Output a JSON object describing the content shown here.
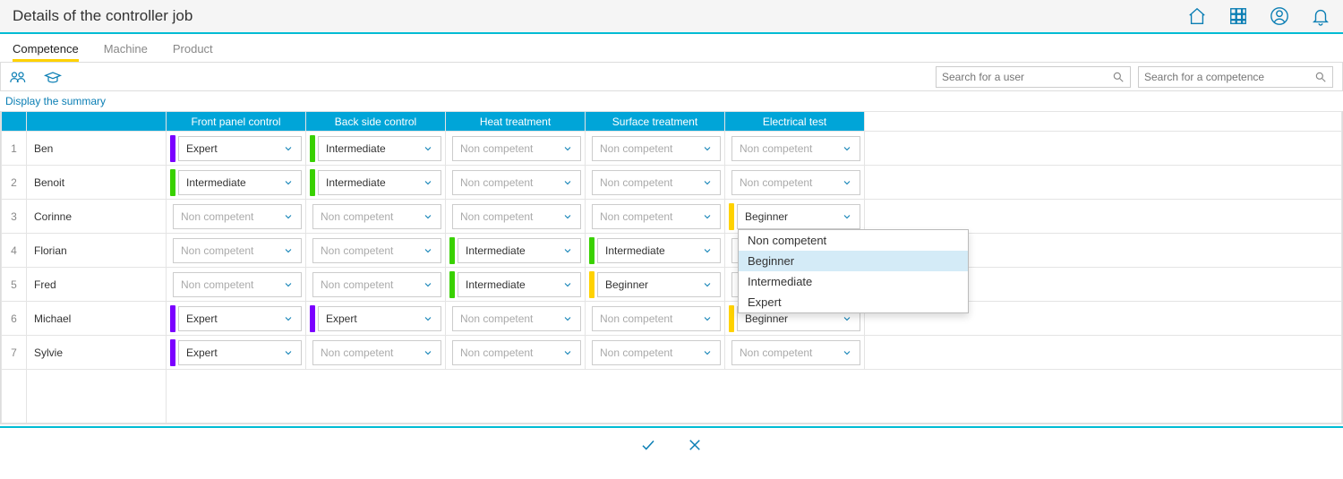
{
  "header": {
    "title": "Details of the controller job"
  },
  "tabs": [
    {
      "label": "Competence",
      "active": true
    },
    {
      "label": "Machine",
      "active": false
    },
    {
      "label": "Product",
      "active": false
    }
  ],
  "toolbar": {
    "search_user_placeholder": "Search for a user",
    "search_comp_placeholder": "Search for a competence"
  },
  "summary_link": "Display the summary",
  "columns": [
    "Front panel control",
    "Back side control",
    "Heat treatment",
    "Surface treatment",
    "Electrical test"
  ],
  "color_map": {
    "Expert": "purple",
    "Intermediate": "green",
    "Beginner": "yellow",
    "Non competent": "none"
  },
  "rows": [
    {
      "idx": "1",
      "name": "Ben",
      "cells": [
        {
          "v": "Expert",
          "c": "purple"
        },
        {
          "v": "Intermediate",
          "c": "green"
        },
        {
          "v": "Non competent",
          "c": "none"
        },
        {
          "v": "Non competent",
          "c": "none"
        },
        {
          "v": "Non competent",
          "c": "none"
        }
      ]
    },
    {
      "idx": "2",
      "name": "Benoit",
      "cells": [
        {
          "v": "Intermediate",
          "c": "green"
        },
        {
          "v": "Intermediate",
          "c": "green"
        },
        {
          "v": "Non competent",
          "c": "none"
        },
        {
          "v": "Non competent",
          "c": "none"
        },
        {
          "v": "Non competent",
          "c": "none"
        }
      ]
    },
    {
      "idx": "3",
      "name": "Corinne",
      "cells": [
        {
          "v": "Non competent",
          "c": "none"
        },
        {
          "v": "Non competent",
          "c": "none"
        },
        {
          "v": "Non competent",
          "c": "none"
        },
        {
          "v": "Non competent",
          "c": "none"
        },
        {
          "v": "Beginner",
          "c": "yellow"
        }
      ]
    },
    {
      "idx": "4",
      "name": "Florian",
      "cells": [
        {
          "v": "Non competent",
          "c": "none"
        },
        {
          "v": "Non competent",
          "c": "none"
        },
        {
          "v": "Intermediate",
          "c": "green"
        },
        {
          "v": "Intermediate",
          "c": "green"
        },
        {
          "v": "Non competent",
          "c": "none"
        }
      ]
    },
    {
      "idx": "5",
      "name": "Fred",
      "cells": [
        {
          "v": "Non competent",
          "c": "none"
        },
        {
          "v": "Non competent",
          "c": "none"
        },
        {
          "v": "Intermediate",
          "c": "green"
        },
        {
          "v": "Beginner",
          "c": "yellow"
        },
        {
          "v": "Non competent",
          "c": "none"
        }
      ]
    },
    {
      "idx": "6",
      "name": "Michael",
      "cells": [
        {
          "v": "Expert",
          "c": "purple"
        },
        {
          "v": "Expert",
          "c": "purple"
        },
        {
          "v": "Non competent",
          "c": "none"
        },
        {
          "v": "Non competent",
          "c": "none"
        },
        {
          "v": "Beginner",
          "c": "yellow"
        }
      ]
    },
    {
      "idx": "7",
      "name": "Sylvie",
      "cells": [
        {
          "v": "Expert",
          "c": "purple"
        },
        {
          "v": "Non competent",
          "c": "none"
        },
        {
          "v": "Non competent",
          "c": "none"
        },
        {
          "v": "Non competent",
          "c": "none"
        },
        {
          "v": "Non competent",
          "c": "none"
        }
      ]
    }
  ],
  "dropdown_open": {
    "row": 2,
    "col": 4,
    "options": [
      "Non competent",
      "Beginner",
      "Intermediate",
      "Expert"
    ],
    "highlighted": "Beginner"
  }
}
